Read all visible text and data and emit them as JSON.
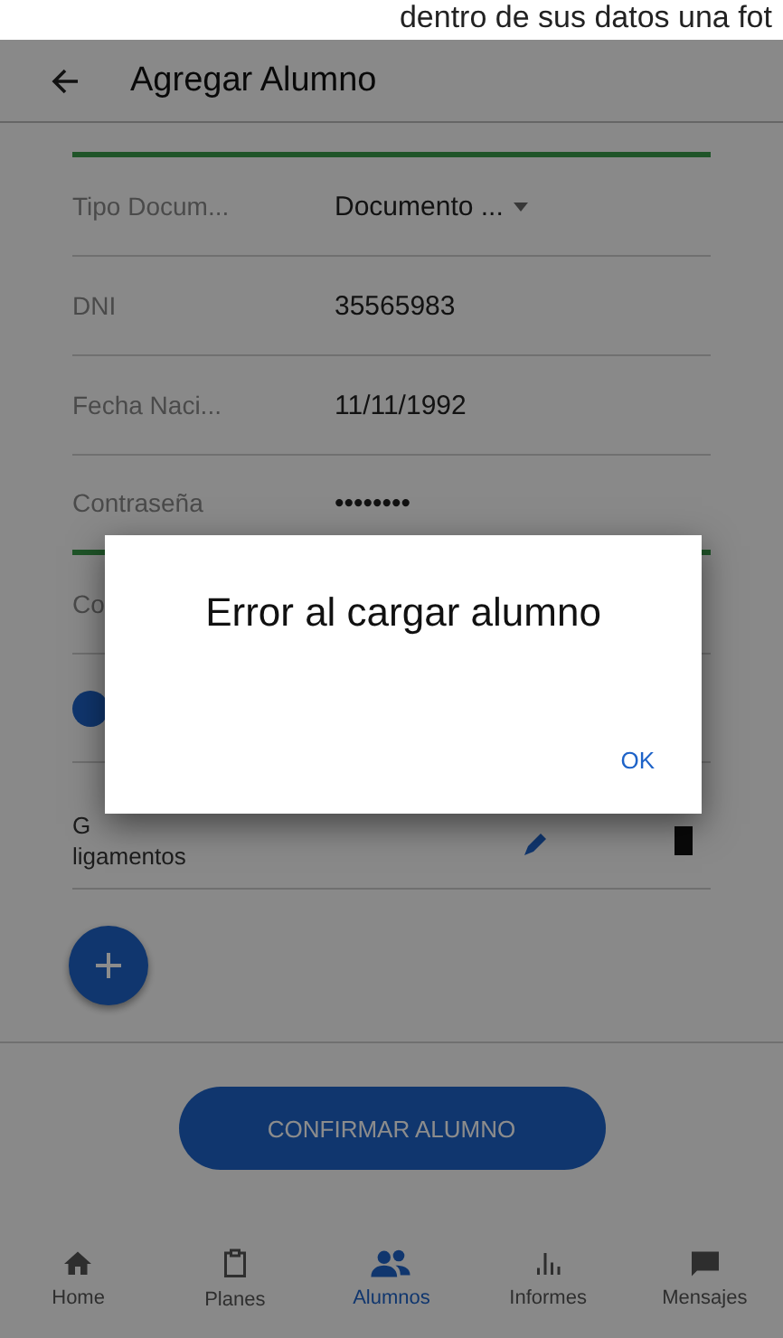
{
  "caption": "dentro de sus datos una fot",
  "app_bar": {
    "title": "Agregar Alumno"
  },
  "fields": [
    {
      "label": "Tipo Docum...",
      "value": "Documento ...",
      "kind": "dropdown",
      "focused": false
    },
    {
      "label": "DNI",
      "value": "35565983",
      "kind": "text",
      "focused": false
    },
    {
      "label": "Fecha Naci...",
      "value": "11/11/1992",
      "kind": "text",
      "focused": false
    },
    {
      "label": "Contraseña",
      "value": "••••••••",
      "kind": "text",
      "focused": true
    },
    {
      "label": "Co",
      "kind": "text",
      "focused": false
    }
  ],
  "injury": {
    "label_lines": [
      "G",
      "ligamentos"
    ]
  },
  "confirm_button": "CONFIRMAR ALUMNO",
  "bottom_nav": [
    {
      "label": "Home",
      "selected": false
    },
    {
      "label": "Planes",
      "selected": false
    },
    {
      "label": "Alumnos",
      "selected": true
    },
    {
      "label": "Informes",
      "selected": false
    },
    {
      "label": "Mensajes",
      "selected": false
    }
  ],
  "dialog": {
    "message": "Error al cargar alumno",
    "button": "OK"
  }
}
